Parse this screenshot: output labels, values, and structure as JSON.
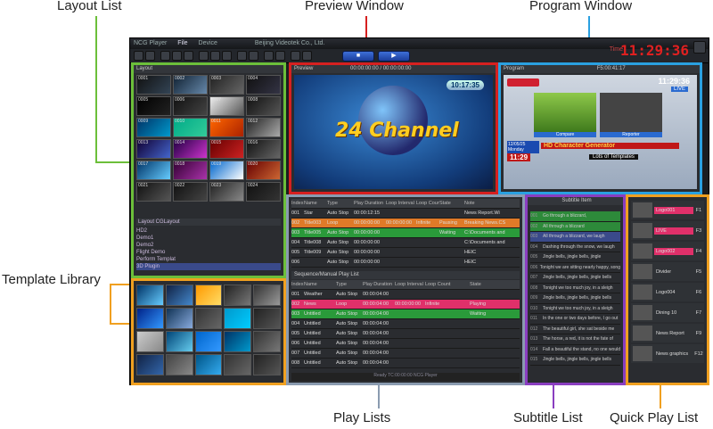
{
  "callouts": {
    "layout_list": "Layout List",
    "preview_window": "Preview Window",
    "program_window": "Program Window",
    "template_library": "Template Library",
    "play_lists": "Play Lists",
    "subtitle_list": "Subtitle List",
    "quick_play_list": "Quick Play List"
  },
  "colors": {
    "layout": "#6cbf3a",
    "preview": "#d62020",
    "program": "#2aa0e0",
    "template": "#f0a020",
    "playlist": "#8a9bb0",
    "subtitle": "#8a3ec0",
    "quickplay": "#f0a020"
  },
  "app": {
    "title_left": "NCG Player",
    "menu_file": "File",
    "menu_device": "Device",
    "company": "Beijing Videotek Co., Ltd.",
    "clock": "11:29:36",
    "clock_label": "Time",
    "layout_title": "Layout",
    "preview_title": "Preview",
    "preview_timecode": "00:00:00:00 / 00:00:00:00",
    "program_title": "Program",
    "program_timecode": "F5:00:41:17",
    "preview_screen": {
      "text": "24 Channel",
      "time": "10:17:35"
    },
    "program_screen": {
      "time": "11:29:36",
      "live": "LIVE",
      "cam1": "Compare",
      "cam2": "Reporter",
      "date": "12/05/25 Monday",
      "ticker": "HD Character Generator",
      "bottom_time": "11:29",
      "tag1": "Lots of Templates"
    }
  },
  "layout_thumbs": [
    "0001",
    "0002",
    "0003",
    "0004",
    "0005",
    "0006",
    "0007",
    "0008",
    "0009",
    "0010",
    "0011",
    "0012",
    "0013",
    "0014",
    "0015",
    "0016",
    "0017",
    "0018",
    "0019",
    "0020",
    "0021",
    "0022",
    "0023",
    "0024"
  ],
  "layout_tree": {
    "tabs": "Layout   CGLayout",
    "items": [
      "HD2",
      "Demo1",
      "Demo2",
      "Flight Demo",
      "Perform Templat",
      "3D Plugin"
    ]
  },
  "playlist_top": {
    "header": [
      "Index",
      "Name",
      "Type",
      "Play Duration",
      "Loop Interval",
      "Loop Count",
      "State",
      "Note"
    ],
    "rows": [
      [
        "001",
        "Star",
        "Auto Stop",
        "00:00:12:15",
        "",
        "",
        "",
        "News Report.Wi"
      ],
      [
        "002",
        "Title003",
        "Loop",
        "00:00:00:00",
        "00:00:00:00",
        "Infinite",
        "Pausing",
        "Breaking News.CS"
      ],
      [
        "003",
        "Title005",
        "Auto Stop",
        "00:00:00:00",
        "",
        "",
        "Waiting",
        "C:\\Documents and"
      ],
      [
        "004",
        "Title008",
        "Auto Stop",
        "00:00:00:00",
        "",
        "",
        "",
        "C:\\Documents and"
      ],
      [
        "005",
        "Title009",
        "Auto Stop",
        "00:00:00:00",
        "",
        "",
        "",
        "HEIC"
      ],
      [
        "006",
        "",
        "Auto Stop",
        "00:00:00:00",
        "",
        "",
        "",
        "HEIC"
      ]
    ]
  },
  "playlist_bottom": {
    "tab": "Sequence/Manual Play List",
    "header": [
      "Index",
      "Name",
      "Type",
      "Play Duration",
      "Loop Interval",
      "Loop Count",
      "State"
    ],
    "rows": [
      [
        "001",
        "Weather",
        "Auto Stop",
        "00:00:04:00",
        "",
        "",
        ""
      ],
      [
        "002",
        "News",
        "Loop",
        "00:00:04:00",
        "00:00:00:00",
        "Infinite",
        "Playing"
      ],
      [
        "003",
        "Untitled",
        "Auto Stop",
        "00:00:04:00",
        "",
        "",
        "Waiting"
      ],
      [
        "004",
        "Untitled",
        "Auto Stop",
        "00:00:04:00",
        "",
        "",
        ""
      ],
      [
        "005",
        "Untitled",
        "Auto Stop",
        "00:00:04:00",
        "",
        "",
        ""
      ],
      [
        "006",
        "Untitled",
        "Auto Stop",
        "00:00:04:00",
        "",
        "",
        ""
      ],
      [
        "007",
        "Untitled",
        "Auto Stop",
        "00:00:04:00",
        "",
        "",
        ""
      ],
      [
        "008",
        "Untitled",
        "Auto Stop",
        "00:00:04:00",
        "",
        "",
        ""
      ]
    ]
  },
  "status_bar": "Ready  TC:00:00:00  NCG Player",
  "subtitles": {
    "header": "Subtitle Item",
    "rows": [
      [
        "001",
        "Go through a blizzard,"
      ],
      [
        "002",
        "All through a blizzard"
      ],
      [
        "003",
        "All through a blizzard, we laugh"
      ],
      [
        "004",
        "Dashing through the snow, we laugh"
      ],
      [
        "005",
        "Jingle bells, jingle bells, jingle"
      ],
      [
        "006",
        "Tonight we are sitting nearly happy, song"
      ],
      [
        "007",
        "Jingle bells, jingle bells, jingle bells"
      ],
      [
        "008",
        "Tonight we too much joy, in a sleigh"
      ],
      [
        "009",
        "Jingle bells, jingle bells, jingle bells"
      ],
      [
        "010",
        "Tonight we too much joy, in a sleigh"
      ],
      [
        "011",
        "In the one or two days before, I go out"
      ],
      [
        "012",
        "The beautiful girl, she sat beside me"
      ],
      [
        "013",
        "The horse, a red, it is not the fate of"
      ],
      [
        "014",
        "Fall a beautiful the stand, no one would"
      ],
      [
        "015",
        "Jingle bells, jingle bells, jingle bells"
      ]
    ]
  },
  "quickplay": [
    [
      "Logo001",
      "F1"
    ],
    [
      "Breaks",
      "F2"
    ],
    [
      "LIVE",
      "F3"
    ],
    [
      "Logo002",
      "F4"
    ],
    [
      "Divider",
      "F5"
    ],
    [
      "Logo004",
      "F6"
    ],
    [
      "Dining 10",
      "F7"
    ],
    [
      "Introduction",
      "F8"
    ],
    [
      "News Report",
      "F9"
    ],
    [
      "Weather",
      "F10"
    ],
    [
      "CG Program",
      "F11"
    ],
    [
      "News graphics",
      "F12"
    ],
    [
      "New Report",
      "F13"
    ]
  ]
}
